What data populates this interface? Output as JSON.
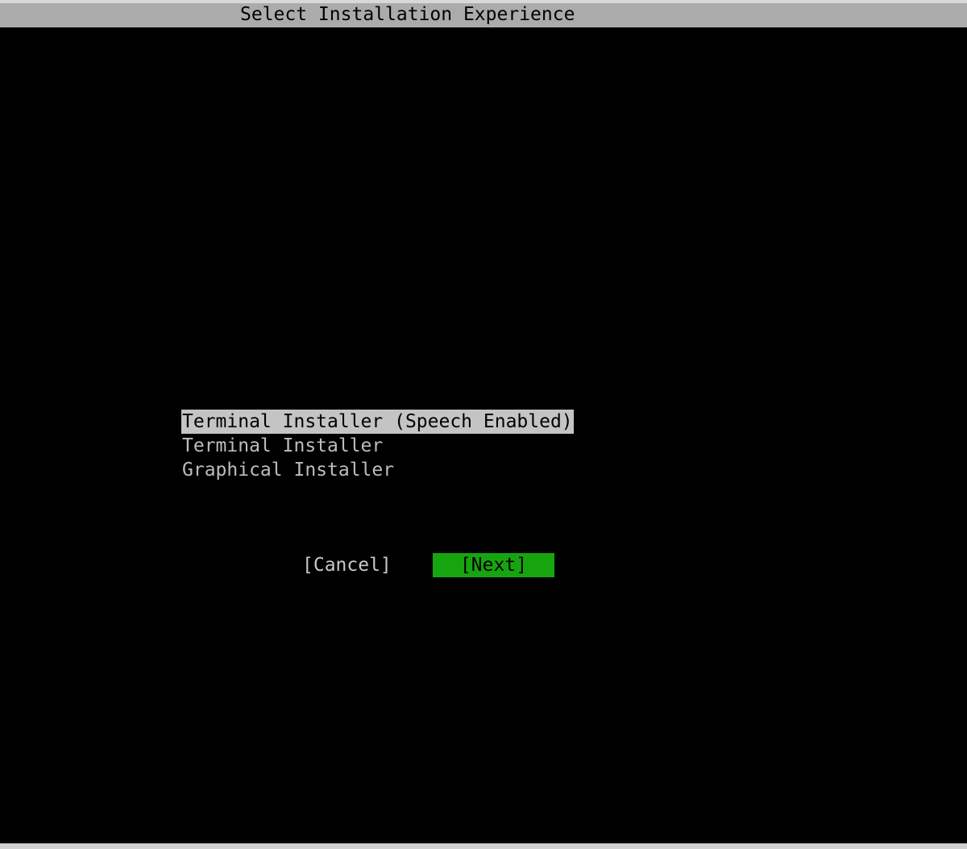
{
  "header": {
    "title": "Select Installation Experience"
  },
  "options": [
    {
      "label": "Terminal Installer (Speech Enabled)",
      "selected": true
    },
    {
      "label": "Terminal Installer",
      "selected": false
    },
    {
      "label": "Graphical Installer",
      "selected": false
    }
  ],
  "buttons": {
    "cancel": "[Cancel]",
    "next": "[Next]"
  },
  "colors": {
    "background": "#000000",
    "title_bar": "#ababab",
    "selected_highlight": "#c4c4c4",
    "next_button": "#17a50f",
    "text": "#bdbdbd"
  }
}
